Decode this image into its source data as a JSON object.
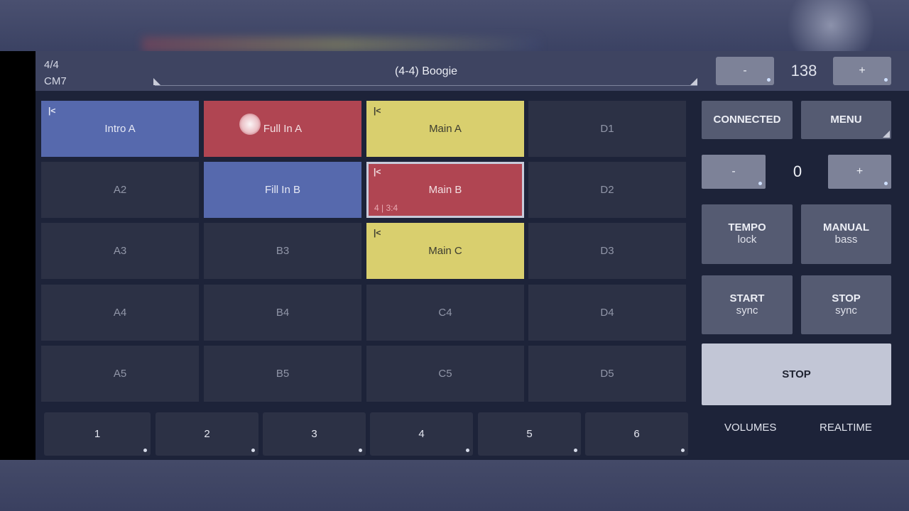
{
  "header": {
    "time_signature": "4/4",
    "chord": "CM7",
    "style_name": "(4-4) Boogie",
    "tempo_minus": "-",
    "tempo_value": "138",
    "tempo_plus": "+"
  },
  "pads": [
    {
      "label": "Intro A",
      "color": "blue",
      "mark": "|<"
    },
    {
      "label": "Full In A",
      "color": "red",
      "mark": ""
    },
    {
      "label": "Main A",
      "color": "yellow",
      "mark": "|<"
    },
    {
      "label": "D1",
      "color": "dark",
      "mark": ""
    },
    {
      "label": "A2",
      "color": "dark",
      "mark": ""
    },
    {
      "label": "Fill In B",
      "color": "blue",
      "mark": ""
    },
    {
      "label": "Main B",
      "color": "red",
      "mark": "|<",
      "sub": "4 | 3:4",
      "selected": true
    },
    {
      "label": "D2",
      "color": "dark",
      "mark": ""
    },
    {
      "label": "A3",
      "color": "dark",
      "mark": ""
    },
    {
      "label": "B3",
      "color": "dark",
      "mark": ""
    },
    {
      "label": "Main C",
      "color": "yellow",
      "mark": "|<"
    },
    {
      "label": "D3",
      "color": "dark",
      "mark": ""
    },
    {
      "label": "A4",
      "color": "dark",
      "mark": ""
    },
    {
      "label": "B4",
      "color": "dark",
      "mark": ""
    },
    {
      "label": "C4",
      "color": "dark",
      "mark": ""
    },
    {
      "label": "D4",
      "color": "dark",
      "mark": ""
    },
    {
      "label": "A5",
      "color": "dark",
      "mark": ""
    },
    {
      "label": "B5",
      "color": "dark",
      "mark": ""
    },
    {
      "label": "C5",
      "color": "dark",
      "mark": ""
    },
    {
      "label": "D5",
      "color": "dark",
      "mark": ""
    }
  ],
  "number_buttons": [
    "1",
    "2",
    "3",
    "4",
    "5",
    "6"
  ],
  "right_panel": {
    "connected": "CONNECTED",
    "menu": "MENU",
    "offset_minus": "-",
    "offset_value": "0",
    "offset_plus": "+",
    "tempo": {
      "line1": "TEMPO",
      "line2": "lock"
    },
    "manual": {
      "line1": "MANUAL",
      "line2": "bass"
    },
    "start": {
      "line1": "START",
      "line2": "sync"
    },
    "stop_sync": {
      "line1": "STOP",
      "line2": "sync"
    },
    "stop": "STOP",
    "volumes": "VOLUMES",
    "realtime": "REALTIME"
  },
  "colors": {
    "blue": "#5669ad",
    "red": "#b04552",
    "yellow": "#d9cf6e",
    "dark": "#2c3145",
    "panel": "#1d2339"
  }
}
